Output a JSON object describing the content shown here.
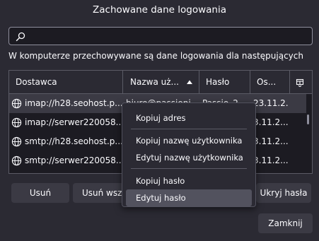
{
  "dialog": {
    "title": "Zachowane dane logowania"
  },
  "search": {
    "placeholder": ""
  },
  "description": "W komputerze przechowywane są dane logowania dla następujących",
  "table": {
    "columns": [
      "Dostawca",
      "Nazwa uż...",
      "Hasło",
      "Os..."
    ],
    "rows": [
      {
        "site": "imap://h28.seohost.p...",
        "user": "biuro@passioni...",
        "password": "Passio_2...",
        "modified": "23.11.2..."
      },
      {
        "site": "imap://serwer220058...",
        "user": "",
        "password": "",
        "modified": "3.11.2..."
      },
      {
        "site": "smtp://h28.seohost.p...",
        "user": "",
        "password": "",
        "modified": "3.11.2..."
      },
      {
        "site": "smtp://serwer220058...",
        "user": "",
        "password": "",
        "modified": "3.11.2..."
      }
    ]
  },
  "buttons": {
    "remove": "Usuń",
    "remove_all": "Usuń wszy",
    "hide_passwords": "Ukryj hasła",
    "close": "Zamknij"
  },
  "context_menu": {
    "copy_address": "Kopiuj adres",
    "copy_username": "Kopiuj nazwę użytkownika",
    "edit_username": "Edytuj nazwę użytkownika",
    "copy_password": "Kopiuj hasło",
    "edit_password": "Edytuj hasło"
  },
  "colors": {
    "background": "#2b2a33",
    "table_bg": "#1c1b22",
    "button_bg": "#3b3a44",
    "menu_highlight": "#52525e",
    "text": "#fbfbfe"
  }
}
